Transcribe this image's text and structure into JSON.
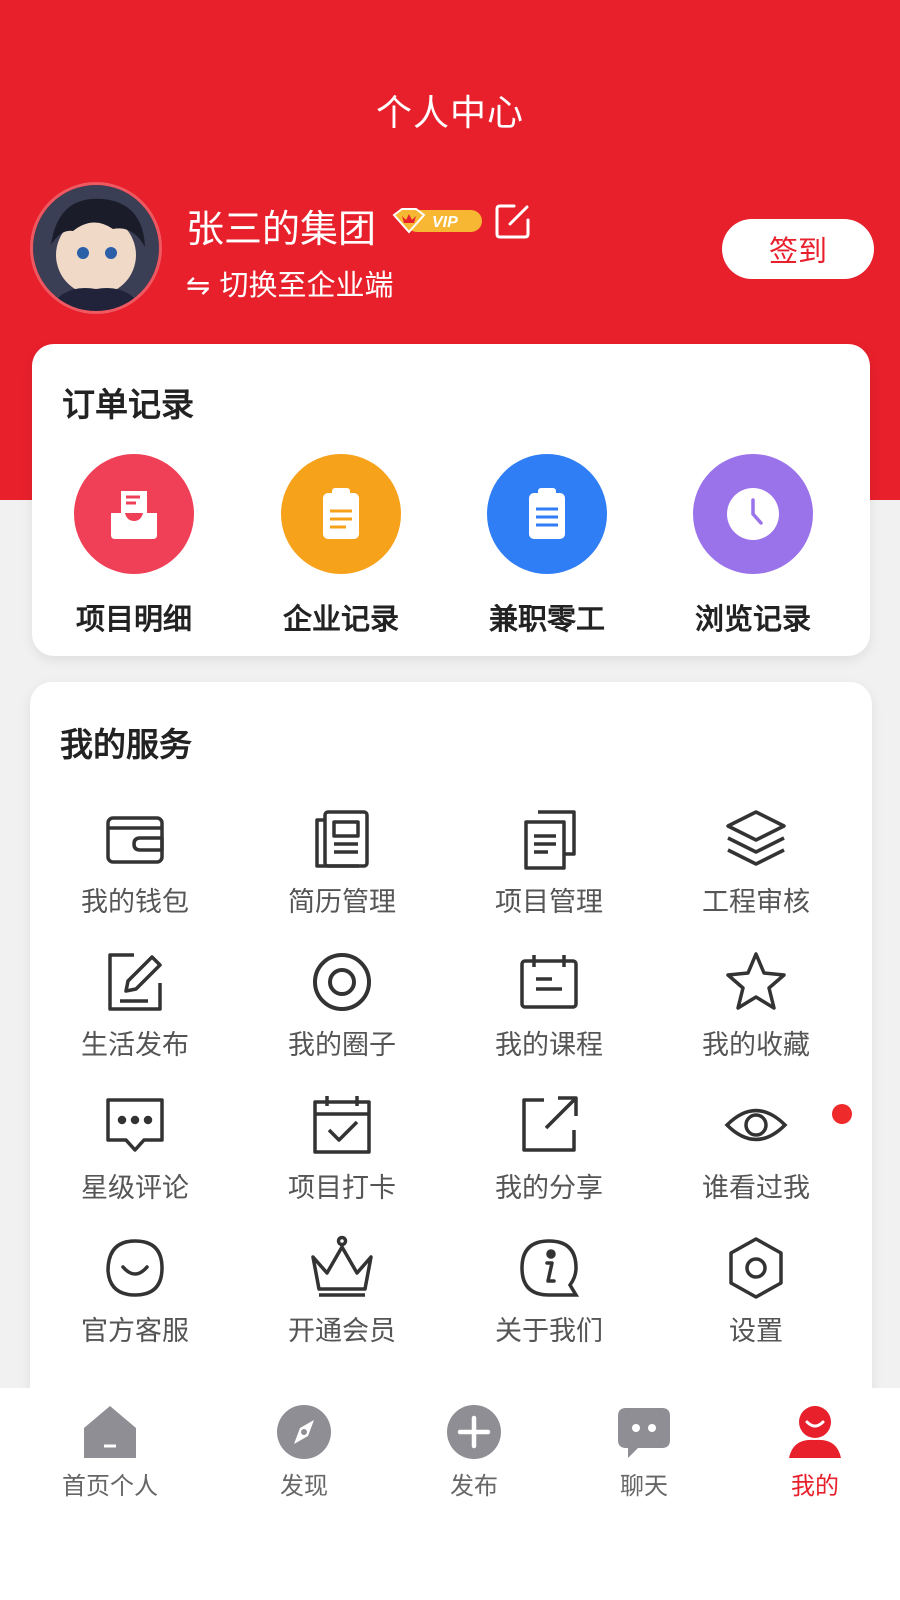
{
  "header": {
    "title": "个人中心",
    "user_name": "张三的集团",
    "vip_text": "VIP",
    "switch_text": "⇋ 切换至企业端",
    "signin_label": "签到"
  },
  "orders": {
    "title": "订单记录",
    "items": [
      {
        "label": "项目明细",
        "icon": "inbox-icon",
        "color": "#f04057"
      },
      {
        "label": "企业记录",
        "icon": "clipboard-icon",
        "color": "#f7a21b"
      },
      {
        "label": "兼职零工",
        "icon": "clipboard-list-icon",
        "color": "#2f7ef5"
      },
      {
        "label": "浏览记录",
        "icon": "clock-icon",
        "color": "#9a73ea"
      }
    ]
  },
  "services": {
    "title": "我的服务",
    "items": [
      {
        "label": "我的钱包",
        "icon": "wallet-icon"
      },
      {
        "label": "简历管理",
        "icon": "resume-icon"
      },
      {
        "label": "项目管理",
        "icon": "documents-icon"
      },
      {
        "label": "工程审核",
        "icon": "layers-icon"
      },
      {
        "label": "生活发布",
        "icon": "edit-icon"
      },
      {
        "label": "我的圈子",
        "icon": "circle-target-icon"
      },
      {
        "label": "我的课程",
        "icon": "calendar-icon"
      },
      {
        "label": "我的收藏",
        "icon": "star-icon"
      },
      {
        "label": "星级评论",
        "icon": "comment-icon"
      },
      {
        "label": "项目打卡",
        "icon": "calendar-check-icon"
      },
      {
        "label": "我的分享",
        "icon": "share-icon"
      },
      {
        "label": "谁看过我",
        "icon": "eye-icon"
      },
      {
        "label": "官方客服",
        "icon": "customer-service-icon"
      },
      {
        "label": "开通会员",
        "icon": "crown-icon"
      },
      {
        "label": "关于我们",
        "icon": "info-icon"
      },
      {
        "label": "设置",
        "icon": "settings-icon"
      }
    ]
  },
  "tabbar": {
    "items": [
      {
        "label": "首页个人",
        "icon": "home-icon"
      },
      {
        "label": "发现",
        "icon": "compass-icon"
      },
      {
        "label": "发布",
        "icon": "plus-icon"
      },
      {
        "label": "聊天",
        "icon": "chat-icon"
      },
      {
        "label": "我的",
        "icon": "profile-icon",
        "active": true
      }
    ]
  },
  "colors": {
    "brand_red": "#e8202c",
    "badge_gold": "#f7b733",
    "tab_inactive": "#8e8e94"
  }
}
